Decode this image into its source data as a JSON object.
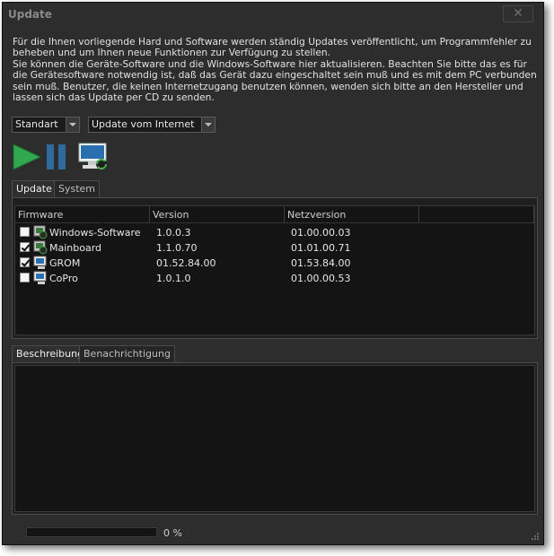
{
  "window": {
    "title": "Update",
    "close_label": "✕"
  },
  "info": {
    "line1": "Für die Ihnen vorliegende Hard und Software werden ständig Updates veröffentlicht, um Programmfehler zu beheben und um Ihnen neue Funktionen zur Verfügung zu stellen.",
    "line2": "Sie können die Geräte-Software und die Windows-Software hier aktualisieren. Beachten Sie bitte das es für die Gerätesoftware notwendig ist, daß das Gerät dazu eingeschaltet sein muß und es mit dem PC verbunden sein muß. Benutzer, die keinen Internetzugang benutzen können, wenden sich bitte an den Hersteller und lassen sich das Update per CD zu senden."
  },
  "controls": {
    "mode_selected": "Standart",
    "source_selected": "Update vom Internet"
  },
  "top_tabs": [
    {
      "label": "Update",
      "active": true
    },
    {
      "label": "System",
      "active": false
    }
  ],
  "table": {
    "columns": [
      "Firmware",
      "Version",
      "Netzversion",
      ""
    ],
    "rows": [
      {
        "name": "Windows-Software",
        "version": "1.0.0.3",
        "net": "01.00.00.03",
        "checked": false,
        "icon": "windows-software-icon"
      },
      {
        "name": "Mainboard",
        "version": "1.1.0.70",
        "net": "01.01.00.71",
        "checked": true,
        "icon": "mainboard-icon"
      },
      {
        "name": "GROM",
        "version": "01.52.84.00",
        "net": "01.53.84.00",
        "checked": true,
        "icon": "grom-icon"
      },
      {
        "name": "CoPro",
        "version": "1.0.1.0",
        "net": "01.00.00.53",
        "checked": false,
        "icon": "copro-icon"
      }
    ]
  },
  "bottom_tabs": [
    {
      "label": "Beschreibung",
      "active": true
    },
    {
      "label": "Benachrichtigung",
      "active": false
    }
  ],
  "status": {
    "progress_percent": 0,
    "progress_text": "0 %"
  },
  "colors": {
    "background": "#2d2d2d",
    "list_background": "#141414",
    "play_green": "#2fa84f",
    "pause_blue": "#2e6a9e"
  }
}
